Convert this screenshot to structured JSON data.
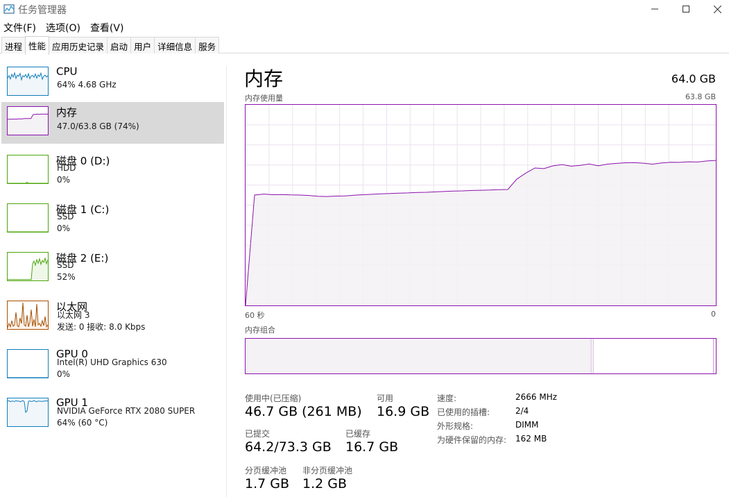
{
  "window": {
    "title": "任务管理器",
    "icons": {
      "app": "task-manager-icon",
      "minimize": "minimize-icon",
      "maximize": "maximize-icon",
      "close": "close-icon"
    }
  },
  "menu": [
    "文件(F)",
    "选项(O)",
    "查看(V)"
  ],
  "tabs": [
    "进程",
    "性能",
    "应用历史记录",
    "启动",
    "用户",
    "详细信息",
    "服务"
  ],
  "active_tab": "性能",
  "resources": [
    {
      "name": "CPU",
      "lines": [
        "64% 4.68 GHz"
      ],
      "color": "#117dbb",
      "fill": "#f1f6fa",
      "selected": false,
      "graph": [
        62,
        70,
        58,
        75,
        65,
        80,
        60,
        72,
        68,
        78,
        55,
        70,
        66,
        74,
        63,
        77,
        59,
        69,
        71,
        64,
        76,
        61,
        73,
        67,
        79,
        57,
        68,
        72,
        65,
        70
      ]
    },
    {
      "name": "内存",
      "lines": [
        "47.0/63.8 GB (74%)"
      ],
      "color": "#8b12ae",
      "fill": "#f4f2f4",
      "selected": true,
      "graph": [
        55,
        56,
        56,
        56,
        56,
        57,
        57,
        57,
        58,
        58,
        58,
        58,
        72,
        73,
        74,
        73,
        74,
        74,
        74,
        74
      ]
    },
    {
      "name": "磁盘 0 (D:)",
      "lines": [
        "HDD",
        "0%"
      ],
      "color": "#4da60c",
      "fill": "#eff7e9",
      "selected": false,
      "graph": [
        0,
        0,
        0,
        0,
        0,
        0,
        0,
        0,
        0,
        0,
        0,
        0,
        0,
        0,
        4,
        0,
        0,
        0,
        0,
        0,
        0,
        0,
        0,
        0,
        0,
        0,
        0,
        0,
        0,
        0
      ]
    },
    {
      "name": "磁盘 1 (C:)",
      "lines": [
        "SSD",
        "0%"
      ],
      "color": "#4da60c",
      "fill": "#eff7e9",
      "selected": false,
      "graph": [
        0,
        0,
        0,
        0,
        0,
        0,
        0,
        0,
        0,
        0,
        0,
        0,
        0,
        0,
        0,
        0,
        0,
        0,
        0,
        0,
        0,
        0,
        0,
        0,
        0,
        0,
        0,
        0,
        0,
        0
      ]
    },
    {
      "name": "磁盘 2 (E:)",
      "lines": [
        "SSD",
        "52%"
      ],
      "color": "#4da60c",
      "fill": "#eff7e9",
      "selected": false,
      "graph": [
        3,
        3,
        3,
        3,
        3,
        3,
        3,
        3,
        3,
        3,
        3,
        3,
        3,
        3,
        3,
        3,
        3,
        3,
        60,
        70,
        55,
        75,
        62,
        78,
        58,
        72,
        65,
        80,
        60,
        74
      ]
    },
    {
      "name": "以太网",
      "lines": [
        "以太网 3",
        "发送: 0 接收: 8.0 Kbps"
      ],
      "color": "#a74f01",
      "fill": "#fcf3eb",
      "selected": false,
      "graph": [
        5,
        20,
        8,
        30,
        10,
        15,
        60,
        12,
        8,
        40,
        20,
        95,
        15,
        10,
        50,
        8,
        25,
        70,
        10,
        35,
        8,
        90,
        15,
        20,
        10,
        30,
        12,
        45,
        8,
        15
      ]
    },
    {
      "name": "GPU 0",
      "lines": [
        "Intel(R) UHD Graphics 630",
        "0%"
      ],
      "color": "#117dbb",
      "fill": "#f1f6fa",
      "selected": false,
      "graph": [
        0,
        0,
        0,
        0,
        0,
        0,
        0,
        0,
        0,
        0,
        0,
        0,
        0,
        0,
        0,
        0,
        0,
        0,
        0,
        0,
        0,
        0,
        0,
        0,
        0,
        0,
        0,
        0,
        0,
        0
      ]
    },
    {
      "name": "GPU 1",
      "lines": [
        "NVIDIA GeForce RTX 2080 SUPER",
        "64% (60 °C)"
      ],
      "color": "#117dbb",
      "fill": "#f1f6fa",
      "selected": false,
      "graph": [
        90,
        92,
        88,
        91,
        90,
        89,
        92,
        90,
        91,
        88,
        90,
        92,
        89,
        50,
        55,
        90,
        91,
        89,
        90,
        92,
        90,
        88,
        91,
        90,
        90,
        89,
        91,
        90,
        92,
        90
      ]
    }
  ],
  "memory": {
    "title": "内存",
    "total": "64.0 GB",
    "usage_label": "内存使用量",
    "usage_max": "63.8 GB",
    "time_left": "60 秒",
    "time_right": "0",
    "composition_label": "内存组合",
    "composition": {
      "in_use": 0.735,
      "modified": 0.005,
      "standby": 0.255,
      "free": 0.005
    },
    "usage_graph": [
      0,
      55,
      55.5,
      55.2,
      55.3,
      55.1,
      55.0,
      54.8,
      54.4,
      54.3,
      54.5,
      54.6,
      54.9,
      55.2,
      55.4,
      55.6,
      55.8,
      56.0,
      56.1,
      56.3,
      56.4,
      56.6,
      56.8,
      57.0,
      57.1,
      57.3,
      57.4,
      57.5,
      57.7,
      57.8,
      63,
      66,
      68.5,
      68.2,
      69.6,
      70.2,
      69.4,
      69.8,
      70.5,
      69.6,
      70.4,
      70.8,
      71.1,
      71.2,
      70.9,
      70.4,
      71.0,
      71.4,
      71.3,
      71.6,
      71.5,
      72.0,
      72.3
    ],
    "stats": {
      "in_use_label": "使用中(已压缩)",
      "in_use_value": "46.7 GB (261 MB)",
      "available_label": "可用",
      "available_value": "16.9 GB",
      "committed_label": "已提交",
      "committed_value": "64.2/73.3 GB",
      "cached_label": "已缓存",
      "cached_value": "16.7 GB",
      "paged_label": "分页缓冲池",
      "paged_value": "1.7 GB",
      "nonpaged_label": "非分页缓冲池",
      "nonpaged_value": "1.2 GB"
    },
    "details": [
      {
        "label": "速度:",
        "value": "2666 MHz"
      },
      {
        "label": "已使用的插槽:",
        "value": "2/4"
      },
      {
        "label": "外形规格:",
        "value": "DIMM"
      },
      {
        "label": "为硬件保留的内存:",
        "value": "162 MB"
      }
    ]
  }
}
